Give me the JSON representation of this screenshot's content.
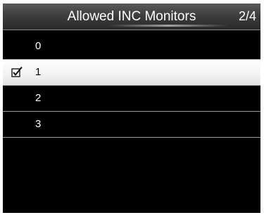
{
  "header": {
    "title": "Allowed INC Monitors",
    "page_indicator": "2/4"
  },
  "list": {
    "items": [
      {
        "label": "0",
        "checked": false,
        "selected": false
      },
      {
        "label": "1",
        "checked": true,
        "selected": true
      },
      {
        "label": "2",
        "checked": false,
        "selected": false
      },
      {
        "label": "3",
        "checked": false,
        "selected": false
      }
    ]
  },
  "icons": {
    "checkbox": "checkbox-checked-icon"
  }
}
